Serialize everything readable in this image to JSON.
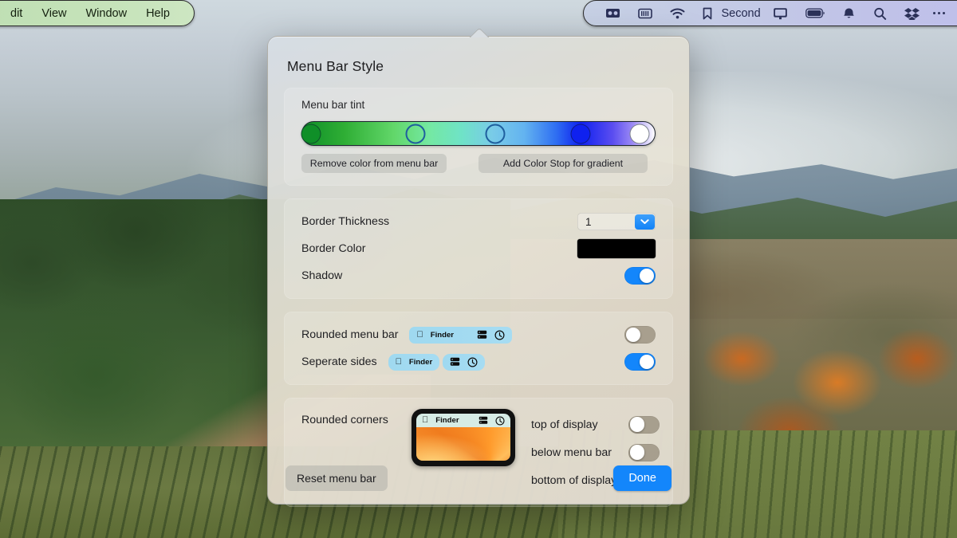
{
  "menubar": {
    "left_items": [
      "dit",
      "View",
      "Window",
      "Help"
    ],
    "right_items": [
      {
        "icon": "photobooth-icon",
        "label": ""
      },
      {
        "icon": "keyboard-brightness-icon",
        "label": ""
      },
      {
        "icon": "wifi-icon",
        "label": ""
      },
      {
        "icon": "bookmark-icon",
        "label": "Second"
      },
      {
        "icon": "display-icon",
        "label": ""
      },
      {
        "icon": "battery-icon",
        "label": ""
      },
      {
        "icon": "bell-icon",
        "label": ""
      },
      {
        "icon": "search-icon",
        "label": ""
      },
      {
        "icon": "dropbox-icon",
        "label": ""
      },
      {
        "icon": "more-dots-icon",
        "label": ""
      }
    ],
    "left_tint": "#c6e3ba",
    "right_tint": "#c2c8e6"
  },
  "popover": {
    "title": "Menu Bar Style",
    "tint": {
      "label": "Menu bar tint",
      "remove_button": "Remove color from menu bar",
      "add_button": "Add Color Stop for gradient",
      "stops": [
        {
          "position": 0,
          "color": "#0f8f28",
          "selected": true
        },
        {
          "position": 26,
          "color": "#62d76a",
          "selected": false
        },
        {
          "position": 50,
          "color": "#79cbe8",
          "selected": false
        },
        {
          "position": 74,
          "color": "#0f21ef",
          "selected": true
        },
        {
          "position": 100,
          "color": "#ffffff",
          "selected": true
        }
      ]
    },
    "border": {
      "thickness_label": "Border Thickness",
      "thickness_value": "1",
      "color_label": "Border Color",
      "color_value": "#000000",
      "shadow_label": "Shadow",
      "shadow_on": true
    },
    "shape": {
      "rounded_label": "Rounded menu bar",
      "rounded_on": false,
      "separate_label": "Seperate sides",
      "separate_on": true,
      "preview_app_name": "Finder"
    },
    "corners": {
      "label": "Rounded corners",
      "preview_app_name": "Finder",
      "options": [
        {
          "label": "top of display",
          "on": false
        },
        {
          "label": "below menu bar",
          "on": false
        },
        {
          "label": "bottom of display",
          "on": true
        }
      ]
    },
    "footer": {
      "reset_label": "Reset menu bar",
      "done_label": "Done",
      "done_color": "#1386fb"
    }
  }
}
